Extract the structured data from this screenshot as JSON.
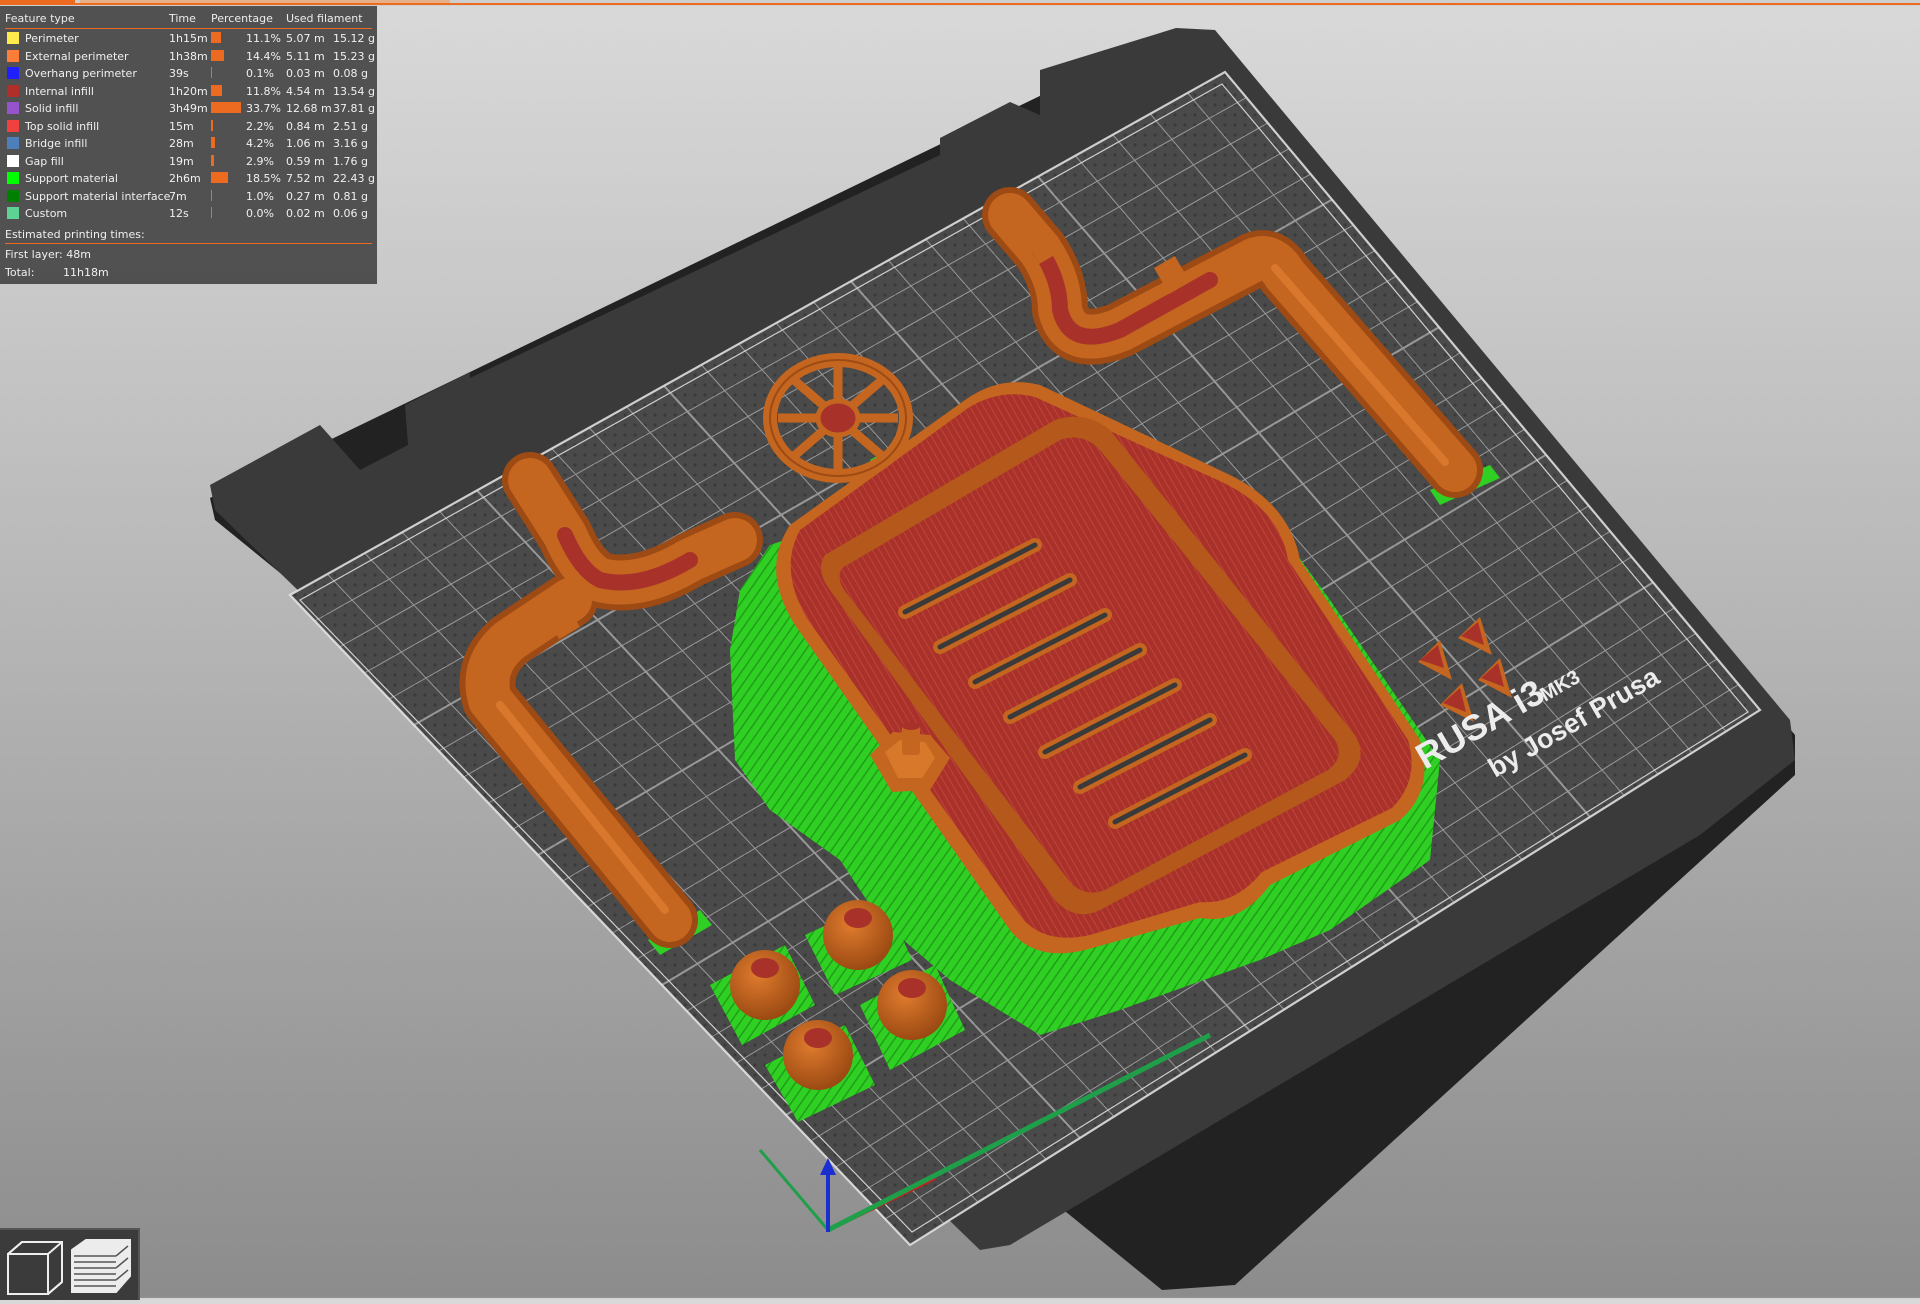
{
  "legend": {
    "header": {
      "feature_type": "Feature type",
      "time": "Time",
      "percentage": "Percentage",
      "used_filament": "Used filament"
    },
    "rows": [
      {
        "label": "Perimeter",
        "color": "#ffe94d",
        "time": "1h15m",
        "percent": "11.1%",
        "length": "5.07 m",
        "weight": "15.12 g",
        "fraction": 0.111
      },
      {
        "label": "External perimeter",
        "color": "#ff7d38",
        "time": "1h38m",
        "percent": "14.4%",
        "length": "5.11 m",
        "weight": "15.23 g",
        "fraction": 0.144
      },
      {
        "label": "Overhang perimeter",
        "color": "#1f1fff",
        "time": "39s",
        "percent": "0.1%",
        "length": "0.03 m",
        "weight": "0.08 g",
        "fraction": 0.001
      },
      {
        "label": "Internal infill",
        "color": "#b03029",
        "time": "1h20m",
        "percent": "11.8%",
        "length": "4.54 m",
        "weight": "13.54 g",
        "fraction": 0.118
      },
      {
        "label": "Solid infill",
        "color": "#9654cc",
        "time": "3h49m",
        "percent": "33.7%",
        "length": "12.68 m",
        "weight": "37.81 g",
        "fraction": 0.337
      },
      {
        "label": "Top solid infill",
        "color": "#f04040",
        "time": "15m",
        "percent": "2.2%",
        "length": "0.84 m",
        "weight": "2.51 g",
        "fraction": 0.022
      },
      {
        "label": "Bridge infill",
        "color": "#4d80ba",
        "time": "28m",
        "percent": "4.2%",
        "length": "1.06 m",
        "weight": "3.16 g",
        "fraction": 0.042
      },
      {
        "label": "Gap fill",
        "color": "#ffffff",
        "time": "19m",
        "percent": "2.9%",
        "length": "0.59 m",
        "weight": "1.76 g",
        "fraction": 0.029
      },
      {
        "label": "Support material",
        "color": "#00ff00",
        "time": "2h6m",
        "percent": "18.5%",
        "length": "7.52 m",
        "weight": "22.43 g",
        "fraction": 0.185
      },
      {
        "label": "Support material interface",
        "color": "#008000",
        "time": "7m",
        "percent": "1.0%",
        "length": "0.27 m",
        "weight": "0.81 g",
        "fraction": 0.01
      },
      {
        "label": "Custom",
        "color": "#5ed194",
        "time": "12s",
        "percent": "0.0%",
        "length": "0.02 m",
        "weight": "0.06 g",
        "fraction": 0.0
      }
    ],
    "estimated_label": "Estimated printing times:",
    "first_layer_label": "First layer:",
    "first_layer_value": "48m",
    "total_label": "Total:",
    "total_value": "11h18m"
  },
  "bed": {
    "logo_line1": "RUSA i3",
    "logo_model": "MK3",
    "logo_line2": "by Josef Prusa"
  },
  "colors": {
    "accent": "#ed6b21",
    "bed_plate": "#3a3a3a",
    "print_orange": "#c4661f",
    "print_red": "#a8322a",
    "support_green": "#2fcf23"
  },
  "view_icons": [
    "iso-cube-icon",
    "layers-icon"
  ]
}
